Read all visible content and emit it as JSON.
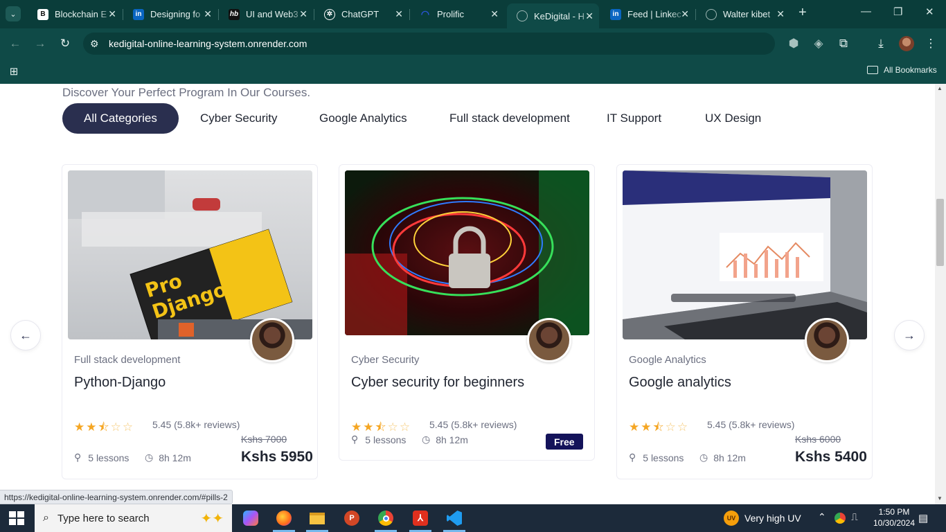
{
  "browser": {
    "tabs": [
      {
        "title": "Blockchain E",
        "icon": "blockchain-favicon",
        "active": false
      },
      {
        "title": "Designing fo",
        "icon": "linkedin-favicon",
        "active": false
      },
      {
        "title": "UI and Web3",
        "icon": "hb-favicon",
        "active": false
      },
      {
        "title": "ChatGPT",
        "icon": "chatgpt-favicon",
        "active": false
      },
      {
        "title": "Prolific",
        "icon": "prolific-favicon",
        "active": false
      },
      {
        "title": "KeDigital - H",
        "icon": "globe-favicon",
        "active": true
      },
      {
        "title": "Feed | Linkec",
        "icon": "linkedin-favicon",
        "active": false
      },
      {
        "title": "Walter kibet",
        "icon": "globe-favicon",
        "active": false
      }
    ],
    "url": "kedigital-online-learning-system.onrender.com",
    "all_bookmarks": "All Bookmarks"
  },
  "page": {
    "intro": "Discover Your Perfect Program In Our Courses.",
    "categories": [
      "All Categories",
      "Cyber Security",
      "Google Analytics",
      "Full stack development",
      "IT Support",
      "UX Design"
    ],
    "active_category": "All Categories",
    "courses": [
      {
        "category": "Full stack development",
        "title": "Python-Django",
        "rating": "5.45 (5.8k+ reviews)",
        "stars_filled": 2.5,
        "old_price": "Kshs 7000",
        "price": "Kshs 5950",
        "lessons": "5 lessons",
        "duration": "8h 12m"
      },
      {
        "category": "Cyber Security",
        "title": "Cyber security for beginners",
        "rating": "5.45 (5.8k+ reviews)",
        "stars_filled": 2.5,
        "old_price": "",
        "price": "Free",
        "lessons": "5 lessons",
        "duration": "8h 12m"
      },
      {
        "category": "Google Analytics",
        "title": "Google analytics",
        "rating": "5.45 (5.8k+ reviews)",
        "stars_filled": 2.5,
        "old_price": "Kshs 6000",
        "price": "Kshs 5400",
        "lessons": "5 lessons",
        "duration": "8h 12m"
      }
    ],
    "status_url": "https://kedigital-online-learning-system.onrender.com/#pills-2"
  },
  "taskbar": {
    "search_placeholder": "Type here to search",
    "weather": "Very high UV",
    "weather_badge": "UV",
    "time": "1:50 PM",
    "date": "10/30/2024"
  },
  "colors": {
    "chrome_dark": "#0a3d3a",
    "chrome": "#0f4a47",
    "pill_active": "#2a2f4f",
    "star": "#f5a623",
    "taskbar": "#1c2a3a"
  }
}
